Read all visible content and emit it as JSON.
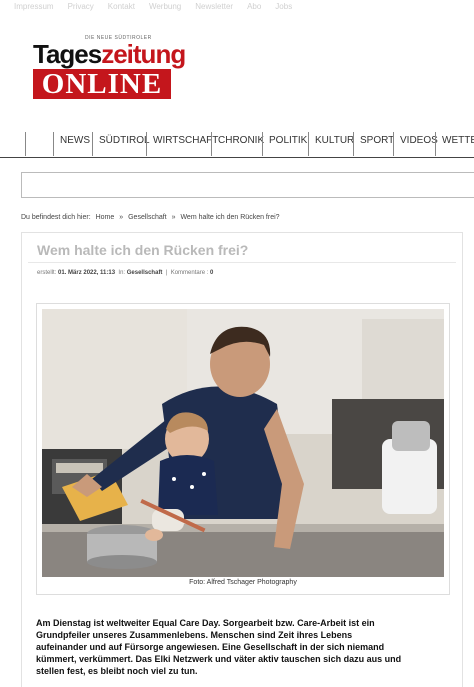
{
  "topbar": {
    "links": [
      "Impressum",
      "Privacy",
      "Kontakt",
      "Werbung",
      "Newsletter",
      "Abo",
      "Jobs"
    ]
  },
  "logo": {
    "tagline": "DIE NEUE SÜDTIROLER",
    "word_part1": "Tages",
    "word_part2": "zeitung",
    "online": "ONLINE"
  },
  "nav": {
    "items": [
      "NEWS",
      "SÜDTIROL",
      "WIRTSCHAFT",
      "CHRONIK",
      "POLITIK",
      "KULTUR",
      "SPORT",
      "VIDEOS",
      "WETTER"
    ]
  },
  "breadcrumb": {
    "prefix": "Du befindest dich hier:",
    "home": "Home",
    "sep": "»",
    "section": "Gesellschaft",
    "current": "Wem halte ich den Rücken frei?"
  },
  "article": {
    "title": "Wem halte ich den Rücken frei?",
    "meta_created_label": "erstellt:",
    "meta_date": "01. März 2022, 11:13",
    "meta_in_label": "In:",
    "meta_section": "Gesellschaft",
    "meta_sep": "|",
    "meta_comments_label": "Kommentare :",
    "meta_comments": "0",
    "photo_caption": "Foto: Alfred Tschager Photography",
    "body_line1": "Am Dienstag ist weltweiter Equal Care Day. Sorgearbeit bzw. Care-Arbeit ist ein",
    "body_line2": "Grundpfeiler unseres Zusammenlebens. Menschen sind Zeit ihres Lebens",
    "body_line3": "aufeinander und auf Fürsorge angewiesen. Eine Gesellschaft in der sich niemand",
    "body_line4": "kümmert, verkümmert. Das Elki Netzwerk und väter aktiv tauschen sich dazu aus und",
    "body_line5": "stellen fest, es bleibt noch viel zu tun."
  },
  "colors": {
    "brand_red": "#c4161c",
    "title_gray": "#b9b9b9"
  }
}
